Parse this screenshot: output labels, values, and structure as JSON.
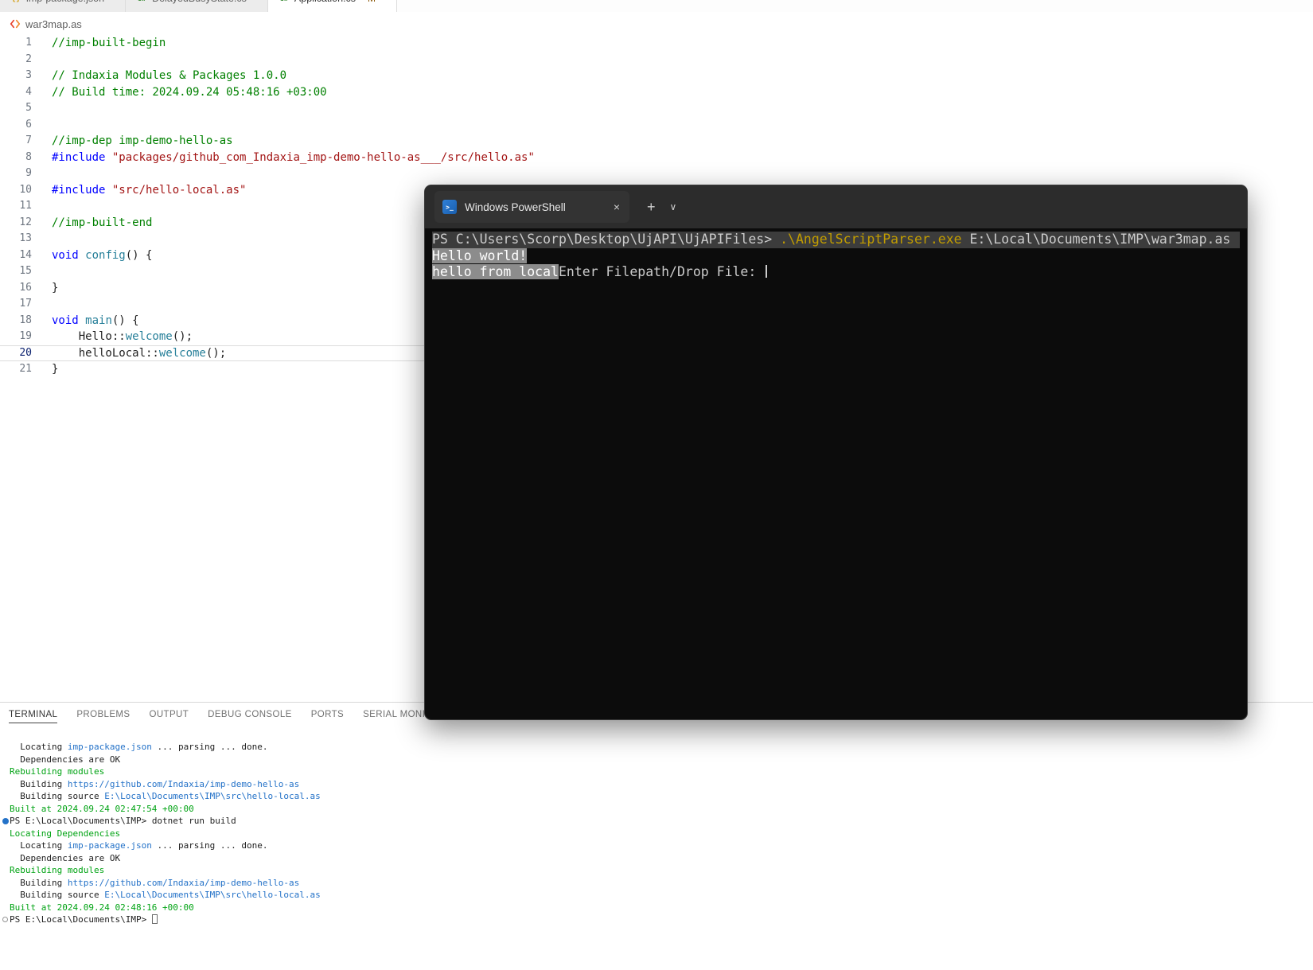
{
  "colors": {
    "comment_green": "#008000",
    "keyword_blue": "#0000ff",
    "string_red": "#a31515",
    "function_teal": "#267f99",
    "terminal_link_blue": "#2472c8",
    "terminal_green": "#00a313",
    "powershell_command_yellow": "#c19c00",
    "powershell_titlebar": "#2c2c2c",
    "powershell_background": "#0c0c0c"
  },
  "editor_tab_bar": {
    "tabs": [
      {
        "label": "imp-package.json",
        "icon": "json-file-icon",
        "icon_glyph": "{}",
        "icon_color": "#d4a017",
        "git": "",
        "active": false
      },
      {
        "label": "DelayedBusyState.cs",
        "icon": "csharp-file-icon",
        "icon_glyph": "C#",
        "icon_color": "#368832",
        "git": "",
        "active": false
      },
      {
        "label": "Application.cs",
        "icon": "csharp-file-icon",
        "icon_glyph": "C#",
        "icon_color": "#368832",
        "git": "M",
        "active": true
      }
    ]
  },
  "breadcrumb": {
    "filename": "war3map.as"
  },
  "code_editor": {
    "active_line": 20,
    "lines": [
      {
        "n": "1",
        "segs": [
          {
            "c": "cm",
            "t": "//imp-built-begin"
          }
        ]
      },
      {
        "n": "2",
        "segs": []
      },
      {
        "n": "3",
        "segs": [
          {
            "c": "cm",
            "t": "// Indaxia Modules & Packages 1.0.0"
          }
        ]
      },
      {
        "n": "4",
        "segs": [
          {
            "c": "cm",
            "t": "// Build time: 2024.09.24 05:48:16 +03:00"
          }
        ]
      },
      {
        "n": "5",
        "segs": []
      },
      {
        "n": "6",
        "segs": []
      },
      {
        "n": "7",
        "segs": [
          {
            "c": "cm",
            "t": "//imp-dep imp-demo-hello-as"
          }
        ]
      },
      {
        "n": "8",
        "segs": [
          {
            "c": "kw",
            "t": "#include"
          },
          {
            "c": "pl",
            "t": " "
          },
          {
            "c": "str",
            "t": "\"packages/github_com_Indaxia_imp-demo-hello-as___/src/hello.as\""
          }
        ]
      },
      {
        "n": "9",
        "segs": []
      },
      {
        "n": "10",
        "segs": [
          {
            "c": "kw",
            "t": "#include"
          },
          {
            "c": "pl",
            "t": " "
          },
          {
            "c": "str",
            "t": "\"src/hello-local.as\""
          }
        ]
      },
      {
        "n": "11",
        "segs": []
      },
      {
        "n": "12",
        "segs": [
          {
            "c": "cm",
            "t": "//imp-built-end"
          }
        ]
      },
      {
        "n": "13",
        "segs": []
      },
      {
        "n": "14",
        "segs": [
          {
            "c": "kw",
            "t": "void"
          },
          {
            "c": "pl",
            "t": " "
          },
          {
            "c": "fn",
            "t": "config"
          },
          {
            "c": "pl",
            "t": "() {"
          }
        ]
      },
      {
        "n": "15",
        "segs": []
      },
      {
        "n": "16",
        "segs": [
          {
            "c": "pl",
            "t": "}"
          }
        ]
      },
      {
        "n": "17",
        "segs": []
      },
      {
        "n": "18",
        "segs": [
          {
            "c": "kw",
            "t": "void"
          },
          {
            "c": "pl",
            "t": " "
          },
          {
            "c": "fn",
            "t": "main"
          },
          {
            "c": "pl",
            "t": "() {"
          }
        ]
      },
      {
        "n": "19",
        "segs": [
          {
            "c": "pl",
            "t": "    Hello::"
          },
          {
            "c": "fn",
            "t": "welcome"
          },
          {
            "c": "pl",
            "t": "();"
          }
        ]
      },
      {
        "n": "20",
        "segs": [
          {
            "c": "pl",
            "t": "    helloLocal::"
          },
          {
            "c": "fn",
            "t": "welcome"
          },
          {
            "c": "pl",
            "t": "();"
          }
        ]
      },
      {
        "n": "21",
        "segs": [
          {
            "c": "pl",
            "t": "}"
          }
        ]
      }
    ]
  },
  "powershell_window": {
    "tab_title": "Windows PowerShell",
    "icon_glyph": ">_",
    "close_label": "×",
    "new_tab_label": "+",
    "dropdown_label": "∨",
    "lines": [
      {
        "fullsel": true,
        "segs": [
          {
            "c": "ps",
            "t": "PS C:\\Users\\Scorp\\Desktop\\UjAPI\\UjAPIFiles> "
          },
          {
            "c": "cmd",
            "t": ".\\AngelScriptParser.exe"
          },
          {
            "c": "ps",
            "t": " E:\\Local\\Documents\\IMP\\war3map.as"
          }
        ]
      },
      {
        "fullsel": false,
        "segs": [
          {
            "c": "sel",
            "t": "Hello world!"
          }
        ]
      },
      {
        "fullsel": false,
        "segs": [
          {
            "c": "sel",
            "t": "hello from local"
          },
          {
            "c": "ps",
            "t": "Enter Filepath/Drop File: "
          },
          {
            "c": "cursor",
            "t": ""
          }
        ]
      }
    ]
  },
  "bottom_panel": {
    "tabs": [
      {
        "label": "TERMINAL",
        "active": true
      },
      {
        "label": "PROBLEMS",
        "active": false
      },
      {
        "label": "OUTPUT",
        "active": false
      },
      {
        "label": "DEBUG CONSOLE",
        "active": false
      },
      {
        "label": "PORTS",
        "active": false
      },
      {
        "label": "SERIAL MONITOR",
        "active": false
      }
    ],
    "output": [
      {
        "deco": "",
        "segs": [
          {
            "c": "pl",
            "t": "  Locating "
          },
          {
            "c": "link",
            "t": "imp-package.json"
          },
          {
            "c": "pl",
            "t": " ... parsing ... done."
          }
        ]
      },
      {
        "deco": "",
        "segs": [
          {
            "c": "pl",
            "t": "  Dependencies are OK"
          }
        ]
      },
      {
        "deco": "",
        "segs": [
          {
            "c": "grn",
            "t": "Rebuilding modules"
          }
        ]
      },
      {
        "deco": "",
        "segs": [
          {
            "c": "pl",
            "t": "  Building "
          },
          {
            "c": "link",
            "t": "https://github.com/Indaxia/imp-demo-hello-as"
          }
        ]
      },
      {
        "deco": "",
        "segs": [
          {
            "c": "pl",
            "t": "  Building source "
          },
          {
            "c": "link",
            "t": "E:\\Local\\Documents\\IMP\\src\\hello-local.as"
          }
        ]
      },
      {
        "deco": "",
        "segs": [
          {
            "c": "grn",
            "t": "Built at 2024.09.24 02:47:54 +00:00"
          }
        ]
      },
      {
        "deco": "dot",
        "segs": [
          {
            "c": "pl",
            "t": "PS E:\\Local\\Documents\\IMP> "
          },
          {
            "c": "pl",
            "t": "dotnet run build"
          }
        ]
      },
      {
        "deco": "",
        "segs": [
          {
            "c": "grn",
            "t": "Locating Dependencies"
          }
        ]
      },
      {
        "deco": "",
        "segs": [
          {
            "c": "pl",
            "t": "  Locating "
          },
          {
            "c": "link",
            "t": "imp-package.json"
          },
          {
            "c": "pl",
            "t": " ... parsing ... done."
          }
        ]
      },
      {
        "deco": "",
        "segs": [
          {
            "c": "pl",
            "t": "  Dependencies are OK"
          }
        ]
      },
      {
        "deco": "",
        "segs": [
          {
            "c": "grn",
            "t": "Rebuilding modules"
          }
        ]
      },
      {
        "deco": "",
        "segs": [
          {
            "c": "pl",
            "t": "  Building "
          },
          {
            "c": "link",
            "t": "https://github.com/Indaxia/imp-demo-hello-as"
          }
        ]
      },
      {
        "deco": "",
        "segs": [
          {
            "c": "pl",
            "t": "  Building source "
          },
          {
            "c": "link",
            "t": "E:\\Local\\Documents\\IMP\\src\\hello-local.as"
          }
        ]
      },
      {
        "deco": "",
        "segs": [
          {
            "c": "grn",
            "t": "Built at 2024.09.24 02:48:16 +00:00"
          }
        ]
      },
      {
        "deco": "circle",
        "segs": [
          {
            "c": "pl",
            "t": "PS E:\\Local\\Documents\\IMP> "
          },
          {
            "c": "cursor-box",
            "t": ""
          }
        ]
      }
    ]
  }
}
